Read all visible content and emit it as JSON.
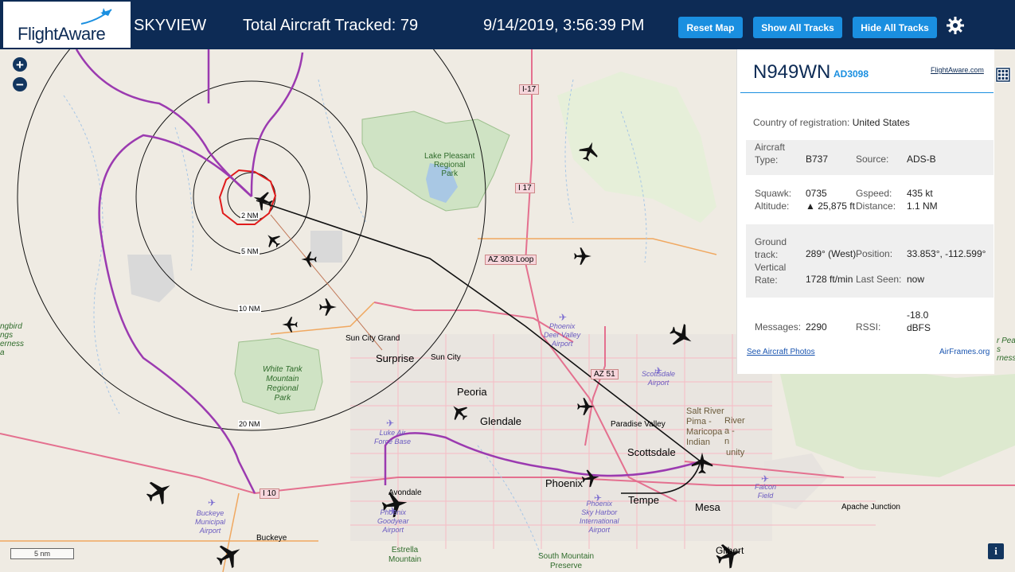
{
  "header": {
    "logo_text": "FlightAware",
    "app_name": "SKYVIEW",
    "total_tracked": "Total Aircraft Tracked: 79",
    "datetime": "9/14/2019, 3:56:39 PM",
    "buttons": {
      "reset": "Reset Map",
      "show_tracks": "Show All Tracks",
      "hide_tracks": "Hide All Tracks"
    }
  },
  "zoom": {
    "in": "+",
    "out": "−"
  },
  "panel": {
    "registration": "N949WN",
    "flight_id": "AD3098",
    "flightaware_link": "FlightAware.com",
    "country_label": "Country of registration:",
    "country_value": "United States",
    "aircraft_type_label_1": "Aircraft",
    "aircraft_type_label_2": "Type:",
    "aircraft_type_value": "B737",
    "source_label": "Source:",
    "source_value": "ADS-B",
    "squawk_label": "Squawk:",
    "squawk_value": "0735",
    "gspeed_label": "Gspeed:",
    "gspeed_value": "435 kt",
    "altitude_label": "Altitude:",
    "altitude_value": "▲ 25,875 ft",
    "distance_label": "Distance:",
    "distance_value": "1.1 NM",
    "ground_label_1": "Ground",
    "ground_label_2": "track:",
    "ground_value": "289° (West)",
    "position_label": "Position:",
    "position_value": "33.853°, -112.599°",
    "vrate_label_1": "Vertical",
    "vrate_label_2": "Rate:",
    "vrate_value": "1728 ft/min",
    "lastseen_label": "Last Seen:",
    "lastseen_value": "now",
    "messages_label": "Messages:",
    "messages_value": "2290",
    "rssi_label": "RSSI:",
    "rssi_value_1": "-18.0",
    "rssi_value_2": "dBFS",
    "photos_link": "See Aircraft Photos",
    "airframes_link": "AirFrames.org"
  },
  "range_rings": [
    "2 NM",
    "5 NM",
    "10 NM",
    "20 NM"
  ],
  "highways": [
    "I-17",
    "I 17",
    "AZ 303 Loop",
    "AZ 51",
    "I 10"
  ],
  "places": {
    "lake_pleasant": [
      "Lake Pleasant",
      "Regional",
      "Park"
    ],
    "white_tank": [
      "White Tank",
      "Mountain",
      "Regional",
      "Park"
    ],
    "sun_city_grand": "Sun City Grand",
    "surprise": "Surprise",
    "sun_city": "Sun City",
    "peoria": "Peoria",
    "glendale": "Glendale",
    "paradise_valley": "Paradise Valley",
    "scottsdale": "Scottsdale",
    "phoenix": "Phoenix",
    "tempe": "Tempe",
    "mesa": "Mesa",
    "avondale": "Avondale",
    "buckeye": "Buckeye",
    "apache_junction": "Apache Junction",
    "gilbert": "Gilbert",
    "salt_river": [
      "Salt River",
      "Pima -",
      "Maricopa",
      "Indian",
      "unity"
    ],
    "salt_river_b": [
      "River",
      "a -",
      "n"
    ],
    "estrella": [
      "Estrella",
      "Mountain"
    ],
    "south_mountain": [
      "South Mountain",
      "Preserve"
    ],
    "left_edge": [
      "ngbird",
      "ngs",
      "erness",
      "a"
    ],
    "right_edge": [
      "r Pea",
      "s",
      "rness"
    ]
  },
  "airports": {
    "deer_valley": [
      "Phoenix",
      "Deer Valley",
      "Airport"
    ],
    "scottsdale": [
      "Scottsdale",
      "Airport"
    ],
    "luke": [
      "Luke Air",
      "Force Base"
    ],
    "goodyear": [
      "Phoenix",
      "Goodyear",
      "Airport"
    ],
    "sky_harbor": [
      "Phoenix",
      "Sky Harbor",
      "International",
      "Airport"
    ],
    "buckeye": [
      "Buckeye",
      "Municipal",
      "Airport"
    ],
    "falcon": [
      "Falcon",
      "Field"
    ]
  },
  "scale": "5 nm",
  "info_button": "i",
  "colors": {
    "header": "#0d2b55",
    "button": "#1a8fe0",
    "track_purple": "#9b3ab0",
    "highlight_red": "#e01b1b"
  }
}
